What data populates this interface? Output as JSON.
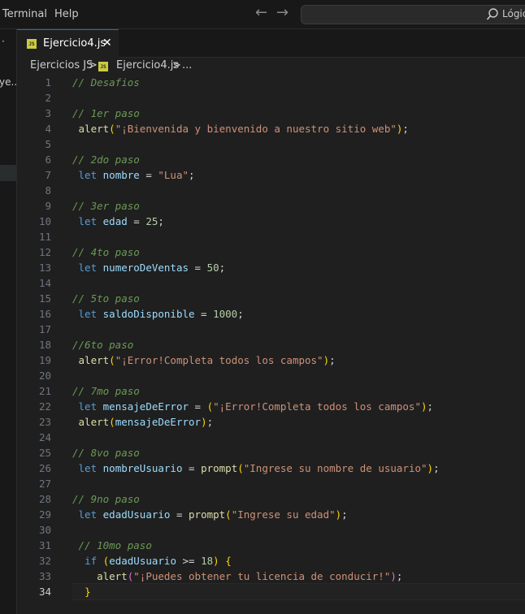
{
  "menu": {
    "terminal": "Terminal",
    "help": "Help"
  },
  "search": {
    "text": "Lógic"
  },
  "sidebar": {
    "dot": "·",
    "partial": "ye..."
  },
  "tab": {
    "filename": "Ejercicio4.js",
    "close": "✕",
    "badge": "JS"
  },
  "breadcrumb": {
    "folder": "Ejercicios JS",
    "file": "Ejercicio4.js",
    "sep": ">",
    "more": "..."
  },
  "editor": {
    "active_line": 34,
    "lines": [
      {
        "n": 1,
        "tokens": [
          {
            "t": "// Desafios",
            "c": "cm"
          }
        ]
      },
      {
        "n": 2,
        "tokens": []
      },
      {
        "n": 3,
        "tokens": [
          {
            "t": "// 1er paso",
            "c": "cm"
          }
        ]
      },
      {
        "n": 4,
        "tokens": [
          {
            "t": " "
          },
          {
            "t": "alert",
            "c": "fn"
          },
          {
            "t": "(",
            "c": "p1"
          },
          {
            "t": "\"¡Bienvenida y bienvenido a nuestro sitio web\"",
            "c": "str"
          },
          {
            "t": ")",
            "c": "p1"
          },
          {
            "t": ";"
          }
        ]
      },
      {
        "n": 5,
        "tokens": []
      },
      {
        "n": 6,
        "tokens": [
          {
            "t": "// 2do paso",
            "c": "cm"
          }
        ]
      },
      {
        "n": 7,
        "tokens": [
          {
            "t": " "
          },
          {
            "t": "let",
            "c": "kw"
          },
          {
            "t": " "
          },
          {
            "t": "nombre",
            "c": "var"
          },
          {
            "t": " = "
          },
          {
            "t": "\"Lua\"",
            "c": "str"
          },
          {
            "t": ";"
          }
        ]
      },
      {
        "n": 8,
        "tokens": []
      },
      {
        "n": 9,
        "tokens": [
          {
            "t": "// 3er paso",
            "c": "cm"
          }
        ]
      },
      {
        "n": 10,
        "tokens": [
          {
            "t": " "
          },
          {
            "t": "let",
            "c": "kw"
          },
          {
            "t": " "
          },
          {
            "t": "edad",
            "c": "var"
          },
          {
            "t": " = "
          },
          {
            "t": "25",
            "c": "num"
          },
          {
            "t": ";"
          }
        ]
      },
      {
        "n": 11,
        "tokens": []
      },
      {
        "n": 12,
        "tokens": [
          {
            "t": "// 4to paso",
            "c": "cm"
          }
        ]
      },
      {
        "n": 13,
        "tokens": [
          {
            "t": " "
          },
          {
            "t": "let",
            "c": "kw"
          },
          {
            "t": " "
          },
          {
            "t": "numeroDeVentas",
            "c": "var"
          },
          {
            "t": " = "
          },
          {
            "t": "50",
            "c": "num"
          },
          {
            "t": ";"
          }
        ]
      },
      {
        "n": 14,
        "tokens": []
      },
      {
        "n": 15,
        "tokens": [
          {
            "t": "// 5to paso",
            "c": "cm"
          }
        ]
      },
      {
        "n": 16,
        "tokens": [
          {
            "t": " "
          },
          {
            "t": "let",
            "c": "kw"
          },
          {
            "t": " "
          },
          {
            "t": "saldoDisponible",
            "c": "var"
          },
          {
            "t": " = "
          },
          {
            "t": "1000",
            "c": "num"
          },
          {
            "t": ";"
          }
        ]
      },
      {
        "n": 17,
        "tokens": []
      },
      {
        "n": 18,
        "tokens": [
          {
            "t": "//6to paso",
            "c": "cm"
          }
        ]
      },
      {
        "n": 19,
        "tokens": [
          {
            "t": " "
          },
          {
            "t": "alert",
            "c": "fn"
          },
          {
            "t": "(",
            "c": "p1"
          },
          {
            "t": "\"¡Error!Completa todos los campos\"",
            "c": "str"
          },
          {
            "t": ")",
            "c": "p1"
          },
          {
            "t": ";"
          }
        ]
      },
      {
        "n": 20,
        "tokens": []
      },
      {
        "n": 21,
        "tokens": [
          {
            "t": "// 7mo paso",
            "c": "cm"
          }
        ]
      },
      {
        "n": 22,
        "tokens": [
          {
            "t": " "
          },
          {
            "t": "let",
            "c": "kw"
          },
          {
            "t": " "
          },
          {
            "t": "mensajeDeError",
            "c": "var"
          },
          {
            "t": " = "
          },
          {
            "t": "(",
            "c": "p1"
          },
          {
            "t": "\"¡Error!Completa todos los campos\"",
            "c": "str"
          },
          {
            "t": ")",
            "c": "p1"
          },
          {
            "t": ";"
          }
        ]
      },
      {
        "n": 23,
        "tokens": [
          {
            "t": " "
          },
          {
            "t": "alert",
            "c": "fn"
          },
          {
            "t": "(",
            "c": "p1"
          },
          {
            "t": "mensajeDeError",
            "c": "var"
          },
          {
            "t": ")",
            "c": "p1"
          },
          {
            "t": ";"
          }
        ]
      },
      {
        "n": 24,
        "tokens": []
      },
      {
        "n": 25,
        "tokens": [
          {
            "t": "// 8vo paso",
            "c": "cm"
          }
        ]
      },
      {
        "n": 26,
        "tokens": [
          {
            "t": " "
          },
          {
            "t": "let",
            "c": "kw"
          },
          {
            "t": " "
          },
          {
            "t": "nombreUsuario",
            "c": "var"
          },
          {
            "t": " = "
          },
          {
            "t": "prompt",
            "c": "fn"
          },
          {
            "t": "(",
            "c": "p1"
          },
          {
            "t": "\"Ingrese su nombre de usuario\"",
            "c": "str"
          },
          {
            "t": ")",
            "c": "p1"
          },
          {
            "t": ";"
          }
        ]
      },
      {
        "n": 27,
        "tokens": []
      },
      {
        "n": 28,
        "tokens": [
          {
            "t": "// 9no paso",
            "c": "cm"
          }
        ]
      },
      {
        "n": 29,
        "tokens": [
          {
            "t": " "
          },
          {
            "t": "let",
            "c": "kw"
          },
          {
            "t": " "
          },
          {
            "t": "edadUsuario",
            "c": "var"
          },
          {
            "t": " = "
          },
          {
            "t": "prompt",
            "c": "fn"
          },
          {
            "t": "(",
            "c": "p1"
          },
          {
            "t": "\"Ingrese su edad\"",
            "c": "str"
          },
          {
            "t": ")",
            "c": "p1"
          },
          {
            "t": ";"
          }
        ]
      },
      {
        "n": 30,
        "tokens": []
      },
      {
        "n": 31,
        "tokens": [
          {
            "t": " "
          },
          {
            "t": "// 10mo paso",
            "c": "cm"
          }
        ]
      },
      {
        "n": 32,
        "tokens": [
          {
            "t": "  "
          },
          {
            "t": "if",
            "c": "kw"
          },
          {
            "t": " "
          },
          {
            "t": "(",
            "c": "p1"
          },
          {
            "t": "edadUsuario",
            "c": "var"
          },
          {
            "t": " >= "
          },
          {
            "t": "18",
            "c": "num"
          },
          {
            "t": ")",
            "c": "p1"
          },
          {
            "t": " "
          },
          {
            "t": "{",
            "c": "p1"
          }
        ]
      },
      {
        "n": 33,
        "tokens": [
          {
            "t": "    "
          },
          {
            "t": "alert",
            "c": "fn"
          },
          {
            "t": "(",
            "c": "p2"
          },
          {
            "t": "\"¡Puedes obtener tu licencia de conducir!\"",
            "c": "str"
          },
          {
            "t": ")",
            "c": "p2"
          },
          {
            "t": ";"
          }
        ]
      },
      {
        "n": 34,
        "tokens": [
          {
            "t": "  "
          },
          {
            "t": "}",
            "c": "p1"
          }
        ]
      }
    ]
  }
}
